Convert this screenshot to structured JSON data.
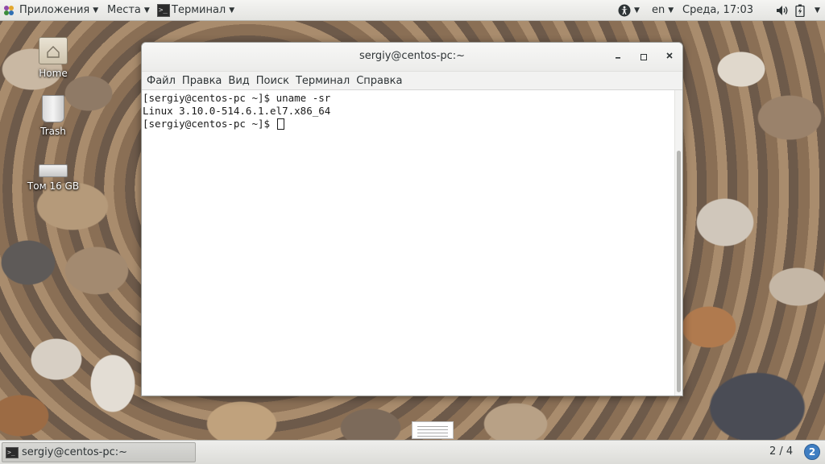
{
  "topbar": {
    "applications_label": "Приложения",
    "places_label": "Места",
    "terminal_label": "Терминал",
    "language": "en",
    "clock": "Среда, 17:03"
  },
  "desktop": {
    "icons": [
      {
        "label": "Home",
        "icon": "home-folder-icon"
      },
      {
        "label": "Trash",
        "icon": "trash-icon"
      },
      {
        "label": "Том 16 GB",
        "icon": "drive-icon"
      }
    ]
  },
  "window": {
    "title": "sergiy@centos-pc:~",
    "menu": [
      "Файл",
      "Правка",
      "Вид",
      "Поиск",
      "Терминал",
      "Справка"
    ],
    "terminal_lines": [
      "[sergiy@centos-pc ~]$ uname -sr",
      "Linux 3.10.0-514.6.1.el7.x86_64",
      "[sergiy@centos-pc ~]$ "
    ]
  },
  "bottombar": {
    "task_label": "sergiy@centos-pc:~",
    "workspace": "2 / 4",
    "notifications": "2"
  },
  "colors": {
    "panel": "#e8e8e6",
    "accent": "#3f7ec2",
    "terminal_bg": "#ffffff",
    "terminal_fg": "#1a1a1a"
  }
}
